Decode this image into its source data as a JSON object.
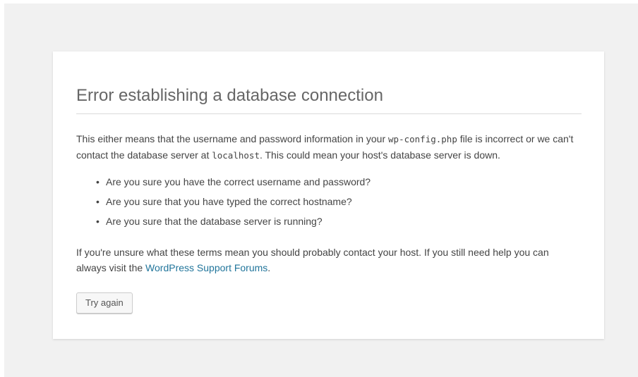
{
  "error": {
    "title": "Error establishing a database connection",
    "para1": {
      "text_before_config": "This either means that the username and password information in your ",
      "config_file": "wp-config.php",
      "text_after_config": " file is incorrect or we can't contact the database server at ",
      "host": "localhost",
      "text_after_host": ". This could mean your host's database server is down."
    },
    "checks": [
      "Are you sure you have the correct username and password?",
      "Are you sure that you have typed the correct hostname?",
      "Are you sure that the database server is running?"
    ],
    "para2": {
      "text_before_link": "If you're unsure what these terms mean you should probably contact your host. If you still need help you can always visit the ",
      "link_text": "WordPress Support Forums",
      "text_after_link": "."
    },
    "button_label": "Try again"
  },
  "colors": {
    "page_background": "#f1f1f1",
    "card_background": "#ffffff",
    "link": "#21759b",
    "text": "#444444",
    "title": "#666666"
  }
}
